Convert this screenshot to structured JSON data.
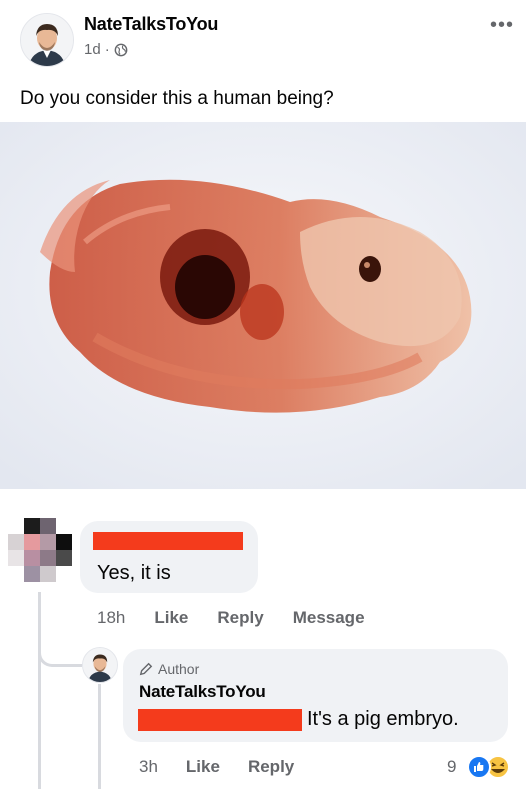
{
  "post": {
    "author": "NateTalksToYou",
    "time": "1d",
    "separator": "·",
    "privacy_icon": "globe-icon",
    "more_icon": "more-options-icon",
    "caption": "Do you consider this a human being?"
  },
  "comments": [
    {
      "text": "Yes, it is",
      "time": "18h",
      "actions": [
        "Like",
        "Reply",
        "Message"
      ]
    },
    {
      "badge": "Author",
      "author": "NateTalksToYou",
      "text": "It's a pig embryo.",
      "time": "3h",
      "actions": [
        "Like",
        "Reply"
      ],
      "reaction_count": "9",
      "reaction_icons": [
        "like-reaction-icon",
        "haha-reaction-icon"
      ]
    }
  ],
  "colors": {
    "redaction": "#f43b1c",
    "bubble": "#f0f2f5",
    "secondary_text": "#65676b",
    "like_blue": "#1877f2",
    "haha_yellow": "#f7c342"
  }
}
